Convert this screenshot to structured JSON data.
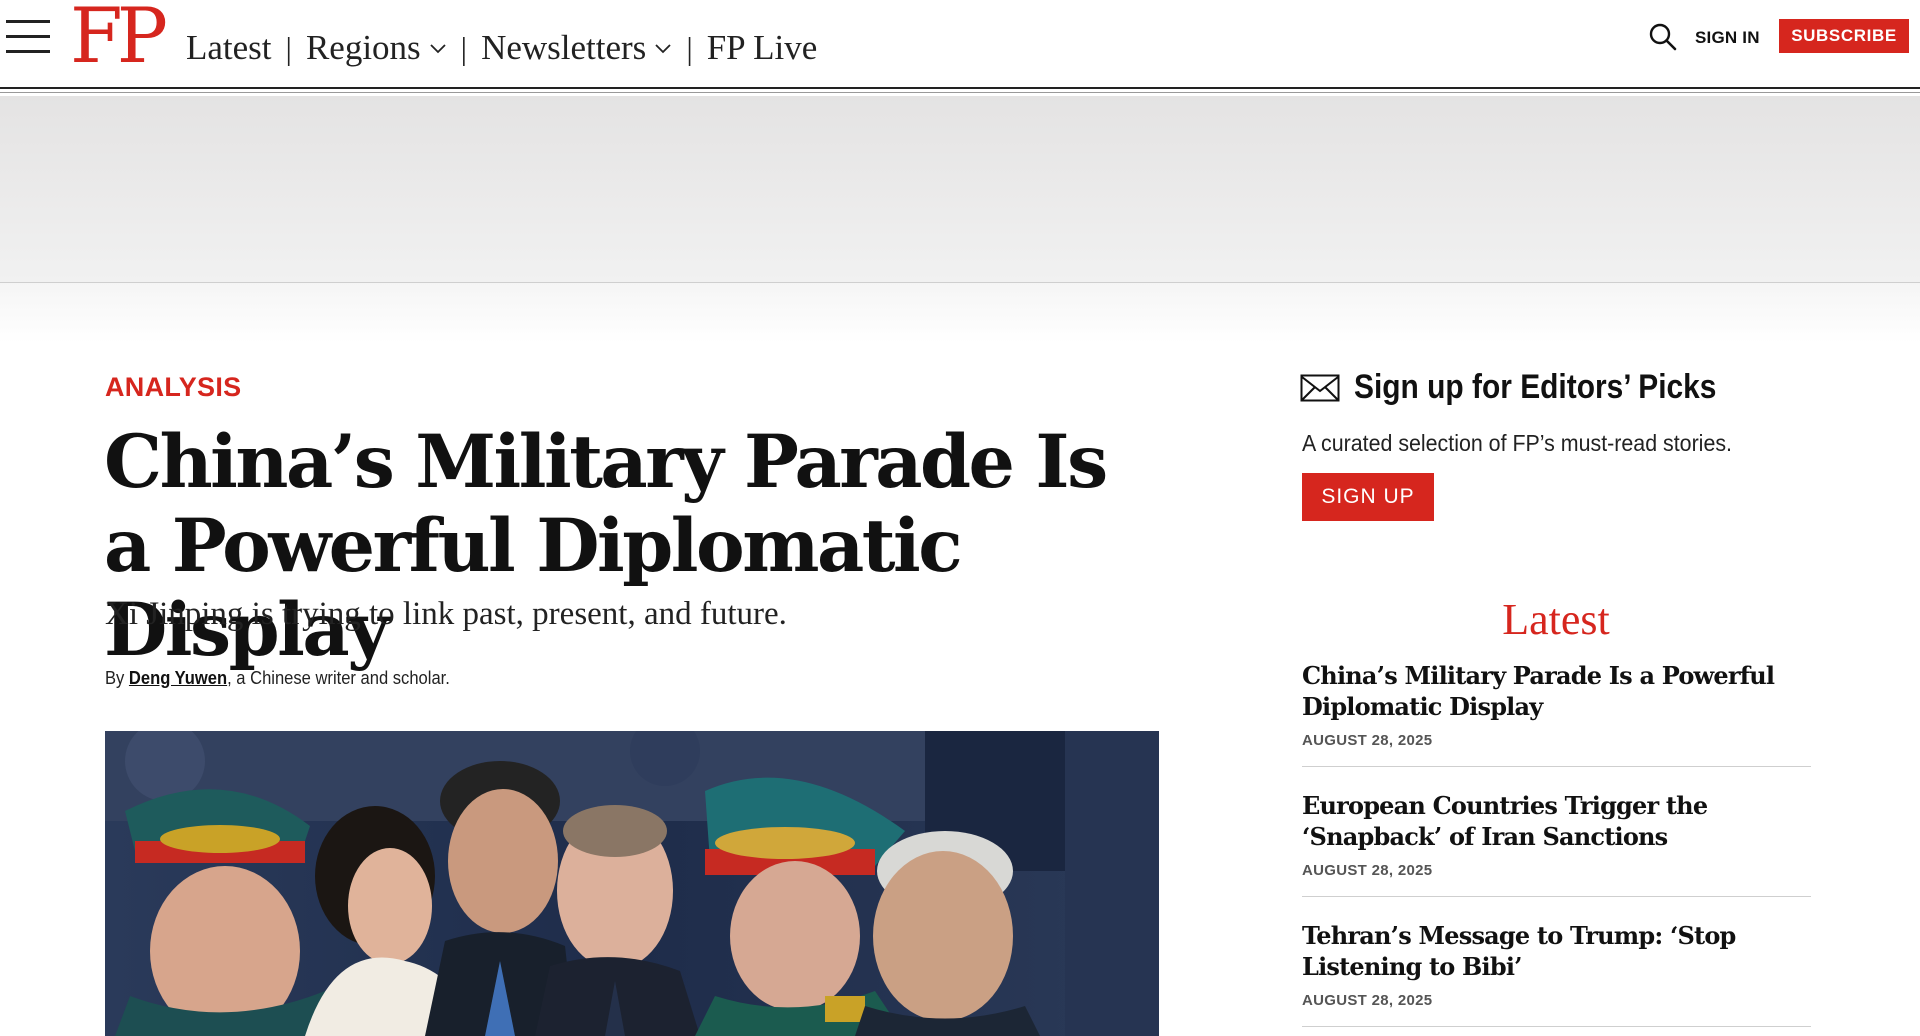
{
  "header": {
    "logo": "FP",
    "nav": [
      {
        "label": "Latest",
        "dropdown": false
      },
      {
        "label": "Regions",
        "dropdown": true
      },
      {
        "label": "Newsletters",
        "dropdown": true
      },
      {
        "label": "FP Live",
        "dropdown": false
      }
    ],
    "separator": "|",
    "sign_in": "SIGN IN",
    "subscribe": "SUBSCRIBE",
    "icons": {
      "menu": "hamburger-menu-icon",
      "search": "search-icon",
      "chevron": "chevron-down-icon"
    },
    "brand_color": "#d6261e"
  },
  "article": {
    "kicker": "ANALYSIS",
    "headline": "China’s Military Parade Is a Powerful Diplomatic Display",
    "dek": "Xi Jinping is trying to link past, present, and future.",
    "byline": {
      "prefix": "By ",
      "author": "Deng Yuwen",
      "suffix": ", a Chinese writer and scholar."
    }
  },
  "sidebar": {
    "newsletter": {
      "icon": "envelope-icon",
      "title": "Sign up for Editors’ Picks",
      "description": "A curated selection of FP’s must-read stories.",
      "button": "SIGN UP"
    },
    "latest": {
      "title": "Latest",
      "items": [
        {
          "title": "China’s Military Parade Is a Powerful Diplomatic Display",
          "date": "AUGUST 28, 2025"
        },
        {
          "title": "European Countries Trigger the ‘Snapback’ of Iran Sanctions",
          "date": "AUGUST 28, 2025"
        },
        {
          "title": "Tehran’s Message to Trump: ‘Stop Listening to Bibi’",
          "date": "AUGUST 28, 2025"
        }
      ]
    }
  }
}
